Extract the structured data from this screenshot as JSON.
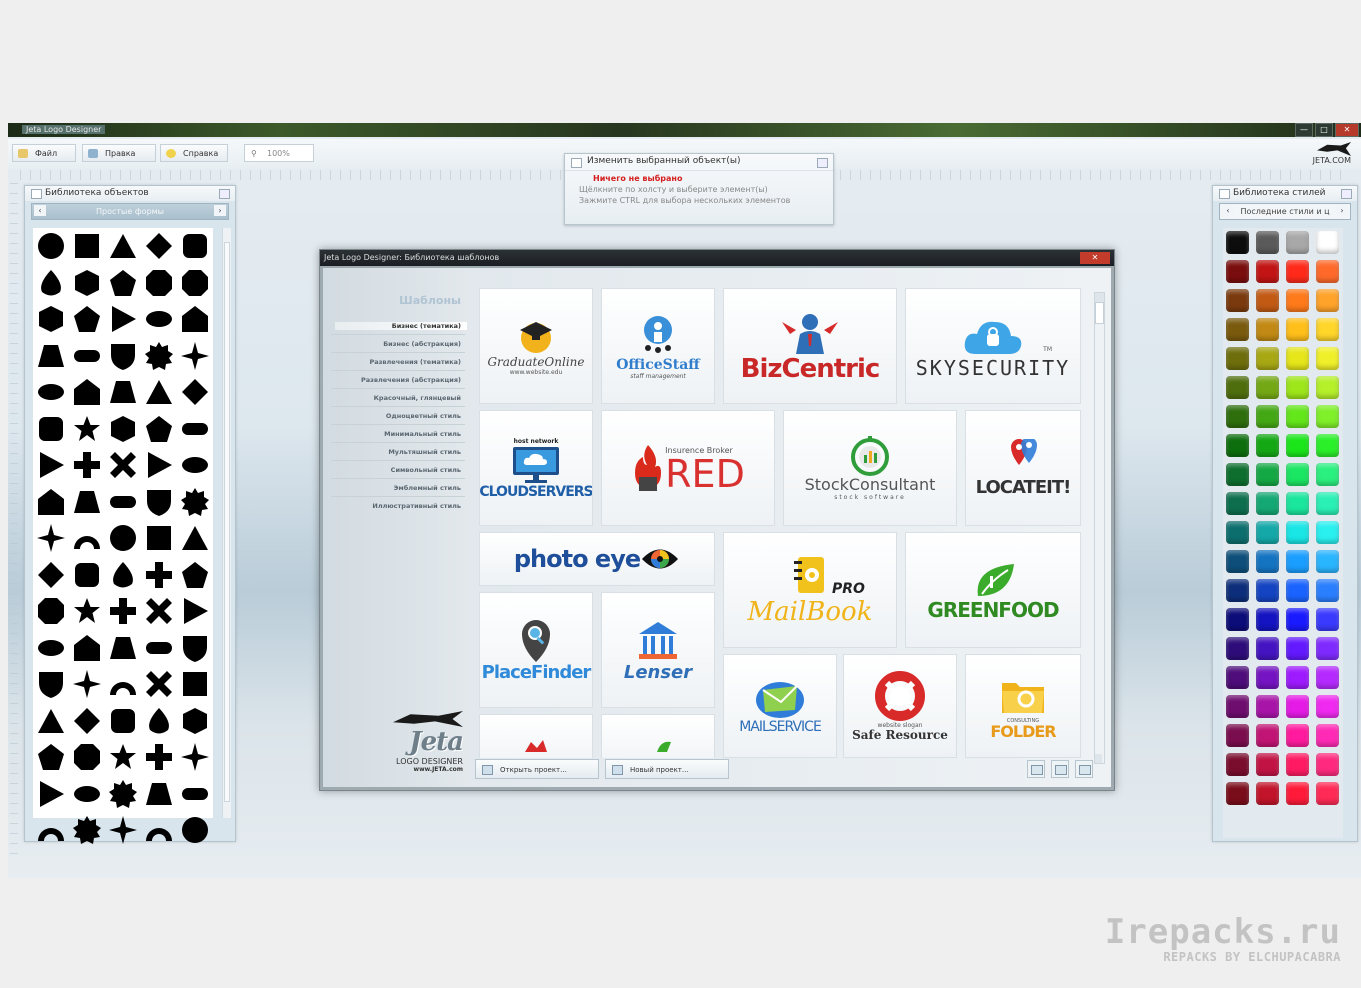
{
  "window": {
    "title": "Jeta Logo Designer",
    "buttons": [
      "—",
      "□",
      "✕"
    ]
  },
  "menu": {
    "file": "Файл",
    "edit": "Правка",
    "help": "Справка",
    "zoom": "100%",
    "brand": "JETA.COM"
  },
  "objects_panel": {
    "title": "Библиотека объектов",
    "selector": "Простые формы",
    "prev": "‹",
    "next": "›"
  },
  "styles_panel": {
    "title": "Библиотека стилей",
    "selector": "Последние стили и ц",
    "prev": "‹",
    "next": "›"
  },
  "info_panel": {
    "title": "Изменить выбранный объект(ы)",
    "status": "Ничего не выбрано",
    "hint1": "Щёлкните по холсту и выберите элемент(ы)",
    "hint2": "Зажмите CTRL для выбора нескольких элементов"
  },
  "dialog": {
    "title": "Jeta Logo Designer: Библиотека шаблонов",
    "close": "✕",
    "categories_title": "Шаблоны",
    "categories": [
      "Бизнес (тематика)",
      "Бизнес (абстракция)",
      "Развлечения (тематика)",
      "Развлечения (абстракция)",
      "Красочный, глянцевый",
      "Одноцветный стиль",
      "Минимальный стиль",
      "Мультяшный стиль",
      "Символьный стиль",
      "Эмблемный стиль",
      "Иллюстративный стиль"
    ],
    "brand_word": "Jeta",
    "brand_sub": "LOGO DESIGNER",
    "brand_www": "www.JETA.com",
    "open_button": "Открыть проект...",
    "new_button": "Новый проект...",
    "templates": {
      "graduate": {
        "name": "GraduateOnline",
        "tag": "www.website.edu"
      },
      "officestaff": {
        "name": "OfficeStaff",
        "tag": "staff management"
      },
      "bizcentric": {
        "name": "BizCentric"
      },
      "skysecurity": {
        "name": "SKYSECURITY",
        "tm": "TM"
      },
      "cloudservers": {
        "name": "CLOUDSERVERS",
        "tag": "host network"
      },
      "red": {
        "name": "RED",
        "tag": "Insurence Broker"
      },
      "stock": {
        "name": "StockConsultant",
        "tag": "stock software"
      },
      "locateit": {
        "name": "LOCATEIT!"
      },
      "photoeye": {
        "name": "photo eye"
      },
      "mailbook": {
        "name": "MailBook",
        "tag": "PRO"
      },
      "greenfood": {
        "name": "GREENFOOD"
      },
      "placefinder": {
        "name": "PlaceFinder"
      },
      "lenser": {
        "name": "Lenser"
      },
      "mailservice": {
        "name": "MAILSERVICE"
      },
      "saferesource": {
        "name": "Safe Resource",
        "tag": "website slogan"
      },
      "folder": {
        "name": "FOLDER",
        "tag": "CONSULTING"
      }
    }
  },
  "watermark": {
    "site": "Irepacks.ru",
    "credit": "REPACKS BY ELCHUPACABRA"
  },
  "colors": {
    "accent": "#2f6fa8",
    "swatches": [
      "#0d0d0d",
      "#5a5a5a",
      "#a8a8a8",
      "#ffffff",
      "#7a0d0d",
      "#c21414",
      "#ff2a1a",
      "#ff6a2a",
      "#7a3a0d",
      "#c25a14",
      "#ff7a1a",
      "#ffa32a",
      "#7a5a0d",
      "#c28a14",
      "#ffbf1a",
      "#ffd62a",
      "#6e6e0d",
      "#a8a814",
      "#e6e61a",
      "#f0f02a",
      "#4e6e0d",
      "#74a814",
      "#9ee61a",
      "#b5f02a",
      "#2e6e0d",
      "#44a814",
      "#63e61a",
      "#7ff02a",
      "#0d6e0d",
      "#14a814",
      "#1ae61a",
      "#2af02a",
      "#0d6e2e",
      "#14a844",
      "#1ae663",
      "#2af07f",
      "#0d6e4e",
      "#14a874",
      "#1ae69e",
      "#2af0b5",
      "#0d6e6e",
      "#14a8a8",
      "#1ae6e6",
      "#2af0f0",
      "#0d4e7a",
      "#1474c2",
      "#1a9eff",
      "#2ab5ff",
      "#0d2e7a",
      "#1444c2",
      "#1a63ff",
      "#2a7fff",
      "#0d0d7a",
      "#1414c2",
      "#1a1aff",
      "#3a3aff",
      "#2e0d7a",
      "#4414c2",
      "#631aff",
      "#7f2aff",
      "#4e0d7a",
      "#7414c2",
      "#9e1aff",
      "#b52aff",
      "#6e0d6e",
      "#a814a8",
      "#e61ae6",
      "#f02af0",
      "#7a0d4e",
      "#c21474",
      "#ff1a9e",
      "#ff2ab5",
      "#7a0d2e",
      "#c21444",
      "#ff1a63",
      "#ff2a7f",
      "#7a0d1a",
      "#c2142a",
      "#ff1a3a",
      "#ff2a55"
    ]
  },
  "shapes": [
    "circle",
    "square",
    "triangle",
    "diamond",
    "rounded-square",
    "teardrop",
    "shield-notch",
    "wave-square",
    "egg",
    "octagon",
    "hexagon-tall",
    "pentagon",
    "heptagon",
    "cube",
    "rhombus-tall",
    "hexagon-round",
    "pentagon-house",
    "rect-notched",
    "flower-hex",
    "rect-wide",
    "ellipse",
    "house",
    "trapezoid",
    "chipped-square",
    "rect-tall",
    "square-plain",
    "star",
    "seal",
    "square-rounded-cut",
    "pill",
    "play",
    "octagon-big",
    "burst-8",
    "triangle-tall",
    "house-round",
    "pentagon-down",
    "corner-L",
    "corner-gamma",
    "square-heavy",
    "bowtie-v",
    "play-round",
    "diamond-round",
    "circle-round",
    "triangle-round",
    "heart-side",
    "star-8",
    "badge-round",
    "badge-gear",
    "cross-plus",
    "triangle-tall-2",
    "bar-tall",
    "bar-rounded",
    "arch",
    "trapezoid-wide",
    "concave-square",
    "square-concave",
    "hex-bell",
    "pentagon-shield",
    "diamond-small",
    "cross-thick",
    "shield",
    "bowtie",
    "shuriken",
    "x-cross",
    "seal-burst",
    "x-big",
    "x-fat",
    "step",
    "flower",
    "diamond-flat",
    "square-tab",
    "shield-2",
    "star-thin",
    "star-sparkle",
    "star-4",
    "star-5",
    "circle-2",
    "gear",
    "star-6",
    "star-5b",
    "semi-ring",
    "starburst",
    "asterisk",
    "snowflake",
    "leaf-down"
  ]
}
